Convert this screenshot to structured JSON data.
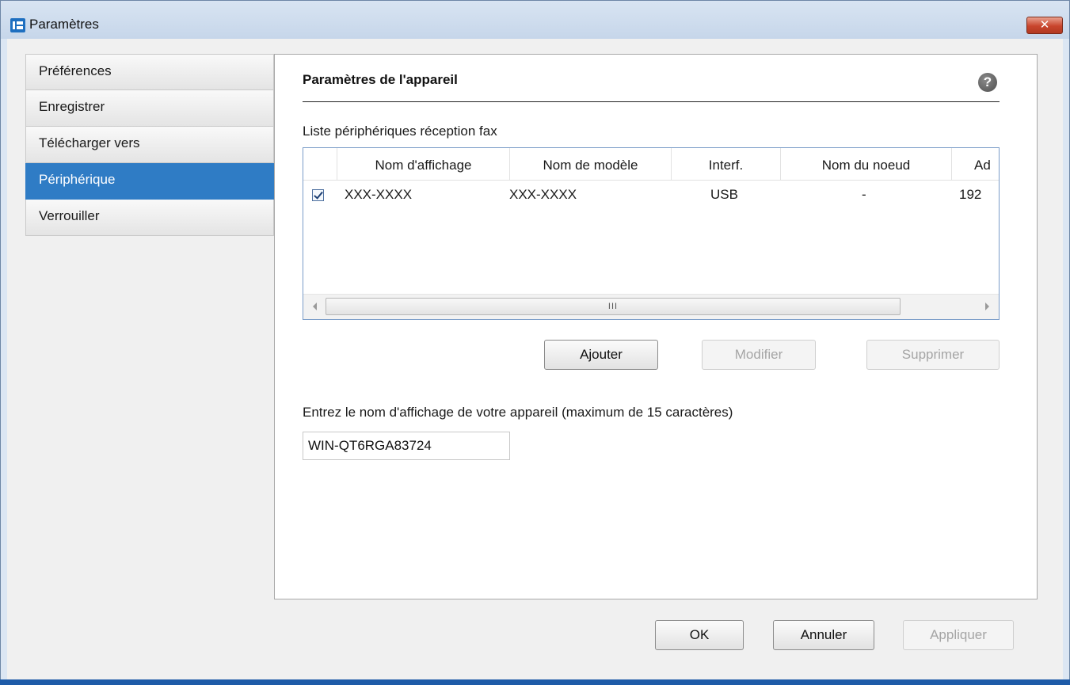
{
  "window": {
    "title": "Paramètres",
    "close_symbol": "✕"
  },
  "nav": {
    "items": [
      {
        "label": "Préférences"
      },
      {
        "label": "Enregistrer"
      },
      {
        "label": "Télécharger vers"
      },
      {
        "label": "Périphérique",
        "selected": true
      },
      {
        "label": "Verrouiller"
      }
    ]
  },
  "panel": {
    "title": "Paramètres de l'appareil",
    "help_symbol": "?",
    "list_caption": "Liste périphériques réception fax",
    "columns": [
      "Nom d'affichage",
      "Nom de modèle",
      "Interf.",
      "Nom du noeud",
      "Ad"
    ],
    "rows": [
      {
        "checked": true,
        "display_name": "XXX-XXXX",
        "model": "XXX-XXXX",
        "interface": "USB",
        "node": "-",
        "address": "192"
      }
    ],
    "scroll_thumb_grip": "III",
    "buttons": {
      "add": "Ajouter",
      "modify": "Modifier",
      "delete": "Supprimer"
    },
    "input_caption": "Entrez le nom d'affichage de votre appareil (maximum de 15 caractères)",
    "input_value": "WIN-QT6RGA83724"
  },
  "footer": {
    "ok": "OK",
    "cancel": "Annuler",
    "apply": "Appliquer"
  },
  "colors": {
    "accent": "#2f7cc5",
    "close": "#c8452d"
  }
}
